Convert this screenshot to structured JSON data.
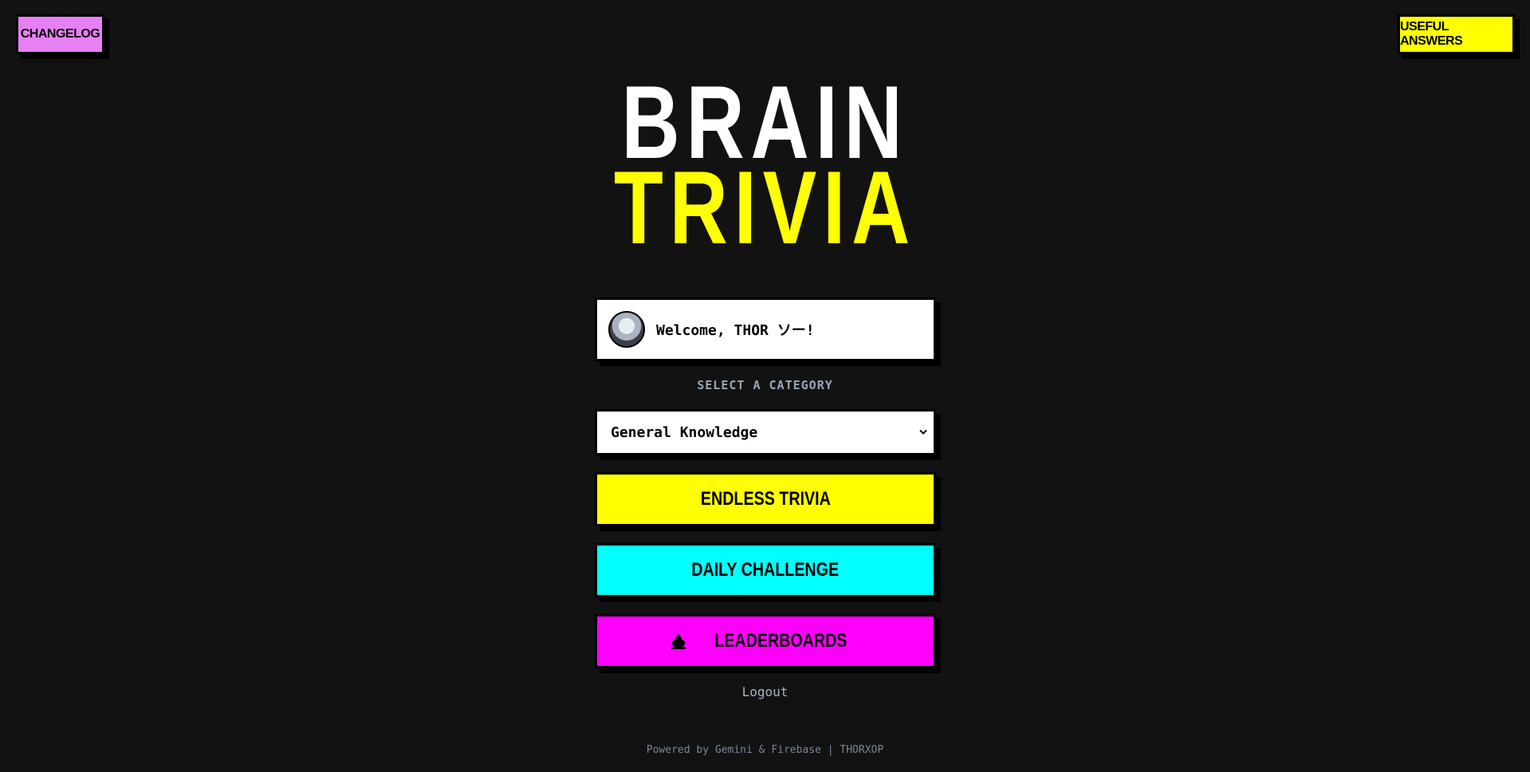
{
  "top_nav": {
    "changelog_label": "CHANGELOG",
    "useful_answers_label": "USEFUL ANSWERS"
  },
  "title": {
    "line1": "BRAIN",
    "line2": "TRIVIA"
  },
  "welcome": {
    "text": "Welcome, THOR ソー!"
  },
  "category": {
    "label": "SELECT A CATEGORY",
    "selected": "General Knowledge"
  },
  "buttons": {
    "endless": "ENDLESS TRIVIA",
    "daily": "DAILY CHALLENGE",
    "leaderboards": "LEADERBOARDS"
  },
  "logout_label": "Logout",
  "footer": {
    "text": "Powered by Gemini & Firebase | THORXOP"
  },
  "colors": {
    "background": "#121212",
    "changelog": "#e880f5",
    "useful": "#ffff00",
    "title_line2": "#ffff00",
    "endless": "#ffff00",
    "daily": "#00ffff",
    "leaderboards": "#ff00ff"
  },
  "icons": {
    "avatar": "avatar",
    "chevron": "chevron-down-icon",
    "trophy": "trophy-icon"
  }
}
